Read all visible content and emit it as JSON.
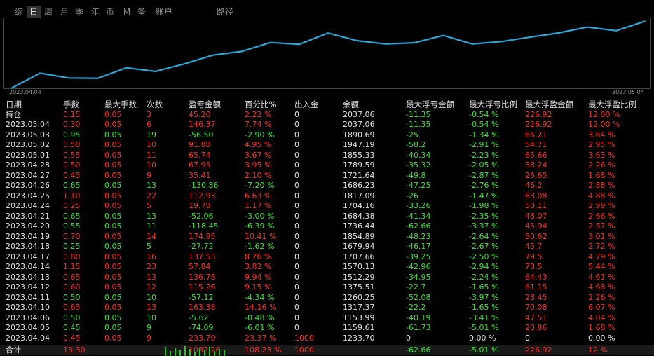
{
  "tabs": [
    {
      "label": "综",
      "active": false
    },
    {
      "label": "日",
      "active": true
    },
    {
      "label": "周",
      "active": false
    },
    {
      "label": "月",
      "active": false
    },
    {
      "label": "季",
      "active": false
    },
    {
      "label": "年",
      "active": false
    },
    {
      "label": "币",
      "active": false
    },
    {
      "label": "M",
      "active": false
    },
    {
      "label": "备",
      "active": false
    },
    {
      "label": "账户",
      "active": false
    },
    {
      "label": "路径",
      "active": false
    }
  ],
  "chart": {
    "start_date": "2023.04.04",
    "end_date": "2023.05.04",
    "line_color": "#2aa7d8"
  },
  "colors": {
    "positive": "#ff2a2a",
    "negative": "#3ae23a",
    "neutral": "#e0e0e0",
    "background": "#000000"
  },
  "table": {
    "columns": [
      "日期",
      "手数",
      "最大手数",
      "次数",
      "盈亏金额",
      "百分比%",
      "出入金",
      "余额",
      "最大浮亏金额",
      "最大浮亏比例",
      "最大浮盈金额",
      "最大浮盈比例"
    ],
    "rows": [
      {
        "values": [
          "持仓",
          "0.15",
          "0.05",
          "3",
          "45.20",
          "2.22 %",
          "0",
          "2037.06",
          "-11.35",
          "-0.54 %",
          "226.92",
          "12.00 %"
        ],
        "tone": [
          "neu",
          "pos",
          "pos",
          "pos",
          "pos",
          "pos",
          "neu",
          "neu",
          "neg",
          "neg",
          "pos",
          "pos"
        ]
      },
      {
        "values": [
          "2023.05.04",
          "0.30",
          "0.05",
          "6",
          "146.37",
          "7.74 %",
          "0",
          "2037.06",
          "-11.35",
          "-0.54 %",
          "226.92",
          "12.00 %"
        ],
        "tone": [
          "neu",
          "pos",
          "pos",
          "pos",
          "pos",
          "pos",
          "neu",
          "neu",
          "neg",
          "neg",
          "pos",
          "pos"
        ]
      },
      {
        "values": [
          "2023.05.03",
          "0.95",
          "0.05",
          "19",
          "-56.50",
          "-2.90 %",
          "0",
          "1890.69",
          "-25",
          "-1.34 %",
          "66.21",
          "3.64 %"
        ],
        "tone": [
          "neu",
          "neg",
          "neg",
          "neg",
          "neg",
          "neg",
          "neu",
          "neu",
          "neg",
          "neg",
          "pos",
          "pos"
        ]
      },
      {
        "values": [
          "2023.05.02",
          "0.50",
          "0.05",
          "10",
          "91.88",
          "4.95 %",
          "0",
          "1947.19",
          "-58.2",
          "-2.91 %",
          "54.71",
          "2.95 %"
        ],
        "tone": [
          "neu",
          "pos",
          "pos",
          "pos",
          "pos",
          "pos",
          "neu",
          "neu",
          "neg",
          "neg",
          "pos",
          "pos"
        ]
      },
      {
        "values": [
          "2023.05.01",
          "0.55",
          "0.05",
          "11",
          "65.74",
          "3.67 %",
          "0",
          "1855.33",
          "-40.34",
          "-2.23 %",
          "65.66",
          "3.63 %"
        ],
        "tone": [
          "neu",
          "pos",
          "pos",
          "pos",
          "pos",
          "pos",
          "neu",
          "neu",
          "neg",
          "neg",
          "pos",
          "pos"
        ]
      },
      {
        "values": [
          "2023.04.28",
          "0.50",
          "0.05",
          "10",
          "67.95",
          "3.95 %",
          "0",
          "1789.59",
          "-35.32",
          "-2.05 %",
          "38.24",
          "2.26 %"
        ],
        "tone": [
          "neu",
          "pos",
          "pos",
          "pos",
          "pos",
          "pos",
          "neu",
          "neu",
          "neg",
          "neg",
          "pos",
          "pos"
        ]
      },
      {
        "values": [
          "2023.04.27",
          "0.45",
          "0.05",
          "9",
          "35.41",
          "2.10 %",
          "0",
          "1721.64",
          "-49.8",
          "-2.87 %",
          "26.65",
          "1.68 %"
        ],
        "tone": [
          "neu",
          "pos",
          "pos",
          "pos",
          "pos",
          "pos",
          "neu",
          "neu",
          "neg",
          "neg",
          "pos",
          "pos"
        ]
      },
      {
        "values": [
          "2023.04.26",
          "0.65",
          "0.05",
          "13",
          "-130.86",
          "-7.20 %",
          "0",
          "1686.23",
          "-47.25",
          "-2.76 %",
          "46.2",
          "2.88 %"
        ],
        "tone": [
          "neu",
          "neg",
          "neg",
          "neg",
          "neg",
          "neg",
          "neu",
          "neu",
          "neg",
          "neg",
          "pos",
          "pos"
        ]
      },
      {
        "values": [
          "2023.04.25",
          "1.10",
          "0.05",
          "22",
          "112.93",
          "6.63 %",
          "0",
          "1817.09",
          "-26",
          "-1.47 %",
          "83.08",
          "4.88 %"
        ],
        "tone": [
          "neu",
          "pos",
          "pos",
          "pos",
          "pos",
          "pos",
          "neu",
          "neu",
          "neg",
          "neg",
          "pos",
          "pos"
        ]
      },
      {
        "values": [
          "2023.04.24",
          "0.25",
          "0.05",
          "5",
          "19.78",
          "1.17 %",
          "0",
          "1704.16",
          "-33.26",
          "-1.98 %",
          "50.11",
          "2.99 %"
        ],
        "tone": [
          "neu",
          "pos",
          "pos",
          "pos",
          "pos",
          "pos",
          "neu",
          "neu",
          "neg",
          "neg",
          "pos",
          "pos"
        ]
      },
      {
        "values": [
          "2023.04.21",
          "0.65",
          "0.05",
          "13",
          "-52.06",
          "-3.00 %",
          "0",
          "1684.38",
          "-41.34",
          "-2.35 %",
          "48.07",
          "2.66 %"
        ],
        "tone": [
          "neu",
          "neg",
          "neg",
          "neg",
          "neg",
          "neg",
          "neu",
          "neu",
          "neg",
          "neg",
          "pos",
          "pos"
        ]
      },
      {
        "values": [
          "2023.04.20",
          "0.55",
          "0.05",
          "11",
          "-118.45",
          "-6.39 %",
          "0",
          "1736.44",
          "-62.66",
          "-3.37 %",
          "45.94",
          "2.57 %"
        ],
        "tone": [
          "neu",
          "neg",
          "neg",
          "neg",
          "neg",
          "neg",
          "neu",
          "neu",
          "neg",
          "neg",
          "pos",
          "pos"
        ]
      },
      {
        "values": [
          "2023.04.19",
          "0.70",
          "0.05",
          "14",
          "174.95",
          "10.41 %",
          "0",
          "1854.89",
          "-48.23",
          "-2.64 %",
          "50.62",
          "3.01 %"
        ],
        "tone": [
          "neu",
          "pos",
          "pos",
          "pos",
          "pos",
          "pos",
          "neu",
          "neu",
          "neg",
          "neg",
          "pos",
          "pos"
        ]
      },
      {
        "values": [
          "2023.04.18",
          "0.25",
          "0.05",
          "5",
          "-27.72",
          "-1.62 %",
          "0",
          "1679.94",
          "-46.17",
          "-2.67 %",
          "45.7",
          "2.72 %"
        ],
        "tone": [
          "neu",
          "neg",
          "neg",
          "neg",
          "neg",
          "neg",
          "neu",
          "neu",
          "neg",
          "neg",
          "pos",
          "pos"
        ]
      },
      {
        "values": [
          "2023.04.17",
          "0.80",
          "0.05",
          "16",
          "137.53",
          "8.76 %",
          "0",
          "1707.66",
          "-39.25",
          "-2.50 %",
          "79.5",
          "4.79 %"
        ],
        "tone": [
          "neu",
          "pos",
          "pos",
          "pos",
          "pos",
          "pos",
          "neu",
          "neu",
          "neg",
          "neg",
          "pos",
          "pos"
        ]
      },
      {
        "values": [
          "2023.04.14",
          "1.15",
          "0.05",
          "23",
          "57.84",
          "3.82 %",
          "0",
          "1570.13",
          "-42.96",
          "-2.94 %",
          "78.5",
          "5.44 %"
        ],
        "tone": [
          "neu",
          "pos",
          "pos",
          "pos",
          "pos",
          "pos",
          "neu",
          "neu",
          "neg",
          "neg",
          "pos",
          "pos"
        ]
      },
      {
        "values": [
          "2023.04.13",
          "0.65",
          "0.05",
          "13",
          "136.78",
          "9.94 %",
          "0",
          "1512.29",
          "-34.95",
          "-2.24 %",
          "64.43",
          "4.61 %"
        ],
        "tone": [
          "neu",
          "pos",
          "pos",
          "pos",
          "pos",
          "pos",
          "neu",
          "neu",
          "neg",
          "neg",
          "pos",
          "pos"
        ]
      },
      {
        "values": [
          "2023.04.12",
          "0.60",
          "0.05",
          "12",
          "115.26",
          "9.15 %",
          "0",
          "1375.51",
          "-22.7",
          "-1.65 %",
          "61.15",
          "4.68 %"
        ],
        "tone": [
          "neu",
          "pos",
          "pos",
          "pos",
          "pos",
          "pos",
          "neu",
          "neu",
          "neg",
          "neg",
          "pos",
          "pos"
        ]
      },
      {
        "values": [
          "2023.04.11",
          "0.50",
          "0.05",
          "10",
          "-57.12",
          "-4.34 %",
          "0",
          "1260.25",
          "-52.08",
          "-3.97 %",
          "28.45",
          "2.26 %"
        ],
        "tone": [
          "neu",
          "neg",
          "neg",
          "neg",
          "neg",
          "neg",
          "neu",
          "neu",
          "neg",
          "neg",
          "pos",
          "pos"
        ]
      },
      {
        "values": [
          "2023.04.10",
          "0.65",
          "0.05",
          "13",
          "163.38",
          "14.16 %",
          "0",
          "1317.37",
          "-22.2",
          "-1.65 %",
          "70.08",
          "6.07 %"
        ],
        "tone": [
          "neu",
          "pos",
          "pos",
          "pos",
          "pos",
          "pos",
          "neu",
          "neu",
          "neg",
          "neg",
          "pos",
          "pos"
        ]
      },
      {
        "values": [
          "2023.04.06",
          "0.50",
          "0.05",
          "10",
          "-5.62",
          "-0.48 %",
          "0",
          "1153.99",
          "-40.19",
          "-3.41 %",
          "47.51",
          "4.04 %"
        ],
        "tone": [
          "neu",
          "neg",
          "neg",
          "neg",
          "neg",
          "neg",
          "neu",
          "neu",
          "neg",
          "neg",
          "pos",
          "pos"
        ]
      },
      {
        "values": [
          "2023.04.05",
          "0.45",
          "0.05",
          "9",
          "-74.09",
          "-6.01 %",
          "0",
          "1159.61",
          "-61.73",
          "-5.01 %",
          "20.86",
          "1.68 %"
        ],
        "tone": [
          "neu",
          "neg",
          "neg",
          "neg",
          "neg",
          "neg",
          "neu",
          "neu",
          "neg",
          "neg",
          "pos",
          "pos"
        ]
      },
      {
        "values": [
          "2023.04.04",
          "0.45",
          "0.05",
          "9",
          "233.70",
          "23.37 %",
          "1000",
          "1233.70",
          "0",
          "0.00 %",
          "0",
          "0.00 %"
        ],
        "tone": [
          "neu",
          "pos",
          "pos",
          "pos",
          "pos",
          "pos",
          "pos",
          "neu",
          "neu",
          "neu",
          "neu",
          "neu"
        ]
      }
    ],
    "total": {
      "values": [
        "合计",
        "13.30",
        "",
        "",
        "1082.26",
        "108.23 %",
        "1000",
        "",
        "-62.66",
        "-5.01 %",
        "226.92",
        "12 %"
      ],
      "tone": [
        "neu",
        "pos",
        "neu",
        "neu",
        "pos",
        "pos",
        "pos",
        "neu",
        "neg",
        "neg",
        "pos",
        "pos"
      ]
    }
  },
  "chart_data": {
    "type": "line",
    "x": [
      "2023.04.04",
      "2023.04.05",
      "2023.04.06",
      "2023.04.10",
      "2023.04.11",
      "2023.04.12",
      "2023.04.13",
      "2023.04.14",
      "2023.04.17",
      "2023.04.18",
      "2023.04.19",
      "2023.04.20",
      "2023.04.21",
      "2023.04.24",
      "2023.04.25",
      "2023.04.26",
      "2023.04.27",
      "2023.04.28",
      "2023.05.01",
      "2023.05.02",
      "2023.05.03",
      "2023.05.04",
      "持仓"
    ],
    "series": [
      {
        "values": [
          1000,
          1233.7,
          1159.61,
          1153.99,
          1317.37,
          1260.25,
          1375.51,
          1512.29,
          1570.13,
          1707.66,
          1679.94,
          1854.89,
          1736.44,
          1684.38,
          1704.16,
          1817.09,
          1686.23,
          1721.64,
          1789.59,
          1855.33,
          1947.19,
          1890.69,
          2037.06
        ]
      }
    ],
    "xlabel": "",
    "ylabel": "",
    "x_tick_labels": [
      "2023.04.04",
      "2023.05.04"
    ],
    "ylim": [
      1000,
      2040
    ],
    "grid": false
  },
  "volume_bars": [
    0.9,
    0.5,
    0.8,
    0.6,
    1.0,
    0.7,
    0.4,
    0.8,
    0.6,
    0.9,
    0.5,
    0.7,
    0.6
  ]
}
